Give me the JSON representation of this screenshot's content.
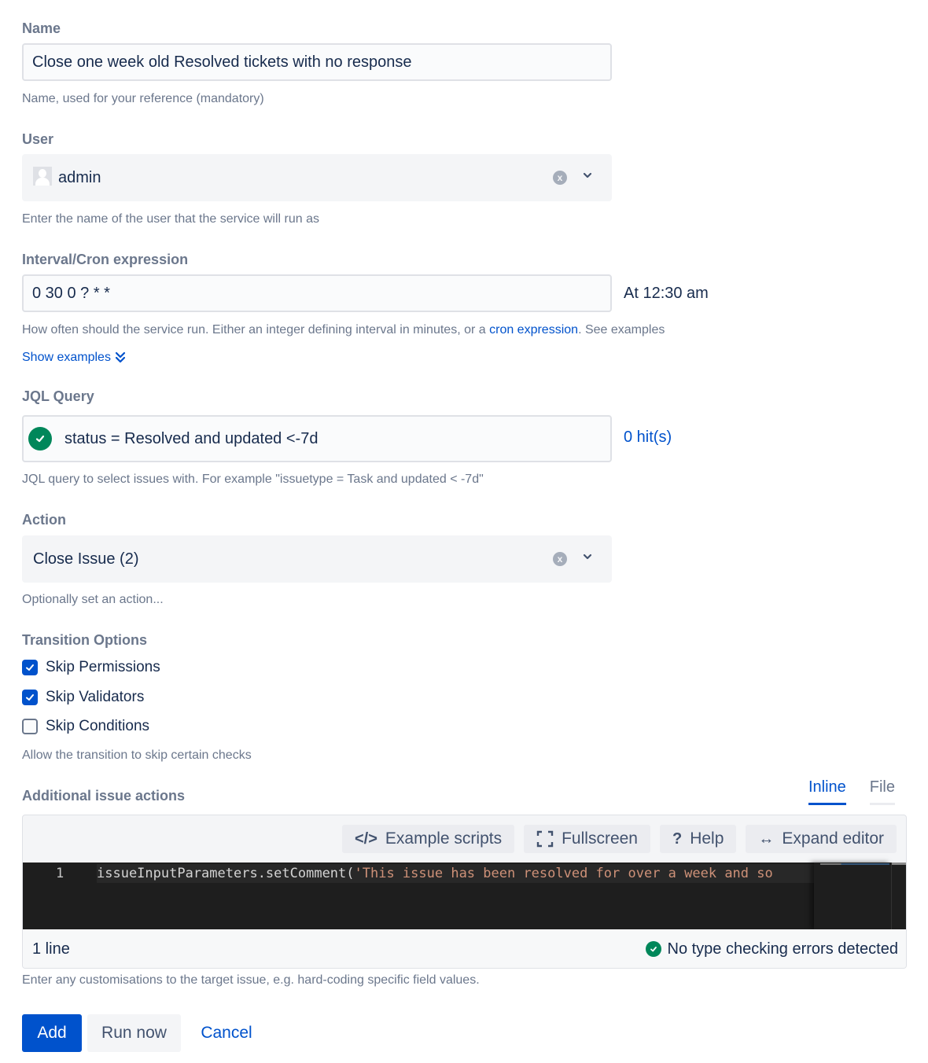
{
  "name_field": {
    "label": "Name",
    "value": "Close one week old Resolved tickets with no response",
    "help": "Name, used for your reference (mandatory)"
  },
  "user_field": {
    "label": "User",
    "value": "admin",
    "avatar_icon": "user-avatar",
    "clear_icon": "x",
    "help": "Enter the name of the user that the service will run as"
  },
  "interval_field": {
    "label": "Interval/Cron expression",
    "value": "0 30 0 ? * *",
    "description": "At 12:30 am",
    "help_prefix": "How often should the service run. Either an integer defining interval in minutes, or a ",
    "help_link": "cron expression",
    "help_suffix": ". See examples",
    "show_examples": "Show examples"
  },
  "jql_field": {
    "label": "JQL Query",
    "value": "status = Resolved and updated <-7d",
    "valid": true,
    "hits": "0 hit(s)",
    "help": "JQL query to select issues with. For example \"issuetype = Task and updated < -7d\""
  },
  "action_field": {
    "label": "Action",
    "value": "Close Issue (2)",
    "clear_icon": "x",
    "help": "Optionally set an action..."
  },
  "transition_options": {
    "label": "Transition Options",
    "options": [
      {
        "label": "Skip Permissions",
        "checked": true
      },
      {
        "label": "Skip Validators",
        "checked": true
      },
      {
        "label": "Skip Conditions",
        "checked": false
      }
    ],
    "help": "Allow the transition to skip certain checks"
  },
  "additional_actions": {
    "label": "Additional issue actions",
    "tabs": [
      {
        "label": "Inline",
        "active": true
      },
      {
        "label": "File",
        "active": false
      }
    ],
    "toolbar": {
      "example_scripts": "Example scripts",
      "fullscreen": "Fullscreen",
      "help": "Help",
      "expand_editor": "Expand editor",
      "example_icon": "</>",
      "help_icon": "?",
      "expand_icon": "↔"
    },
    "code": {
      "line_number": "1",
      "plain": "issueInputParameters.setComment(",
      "string": "'This issue has been resolved for over a week and so"
    },
    "status": {
      "line_count": "1 line",
      "type_check": "No type checking errors detected"
    },
    "help": "Enter any customisations to the target issue, e.g. hard-coding specific field values."
  },
  "buttons": {
    "add": "Add",
    "run_now": "Run now",
    "cancel": "Cancel"
  },
  "colors": {
    "primary": "#0052cc",
    "success": "#00875a",
    "label": "#6b778c",
    "text": "#172b4d"
  }
}
